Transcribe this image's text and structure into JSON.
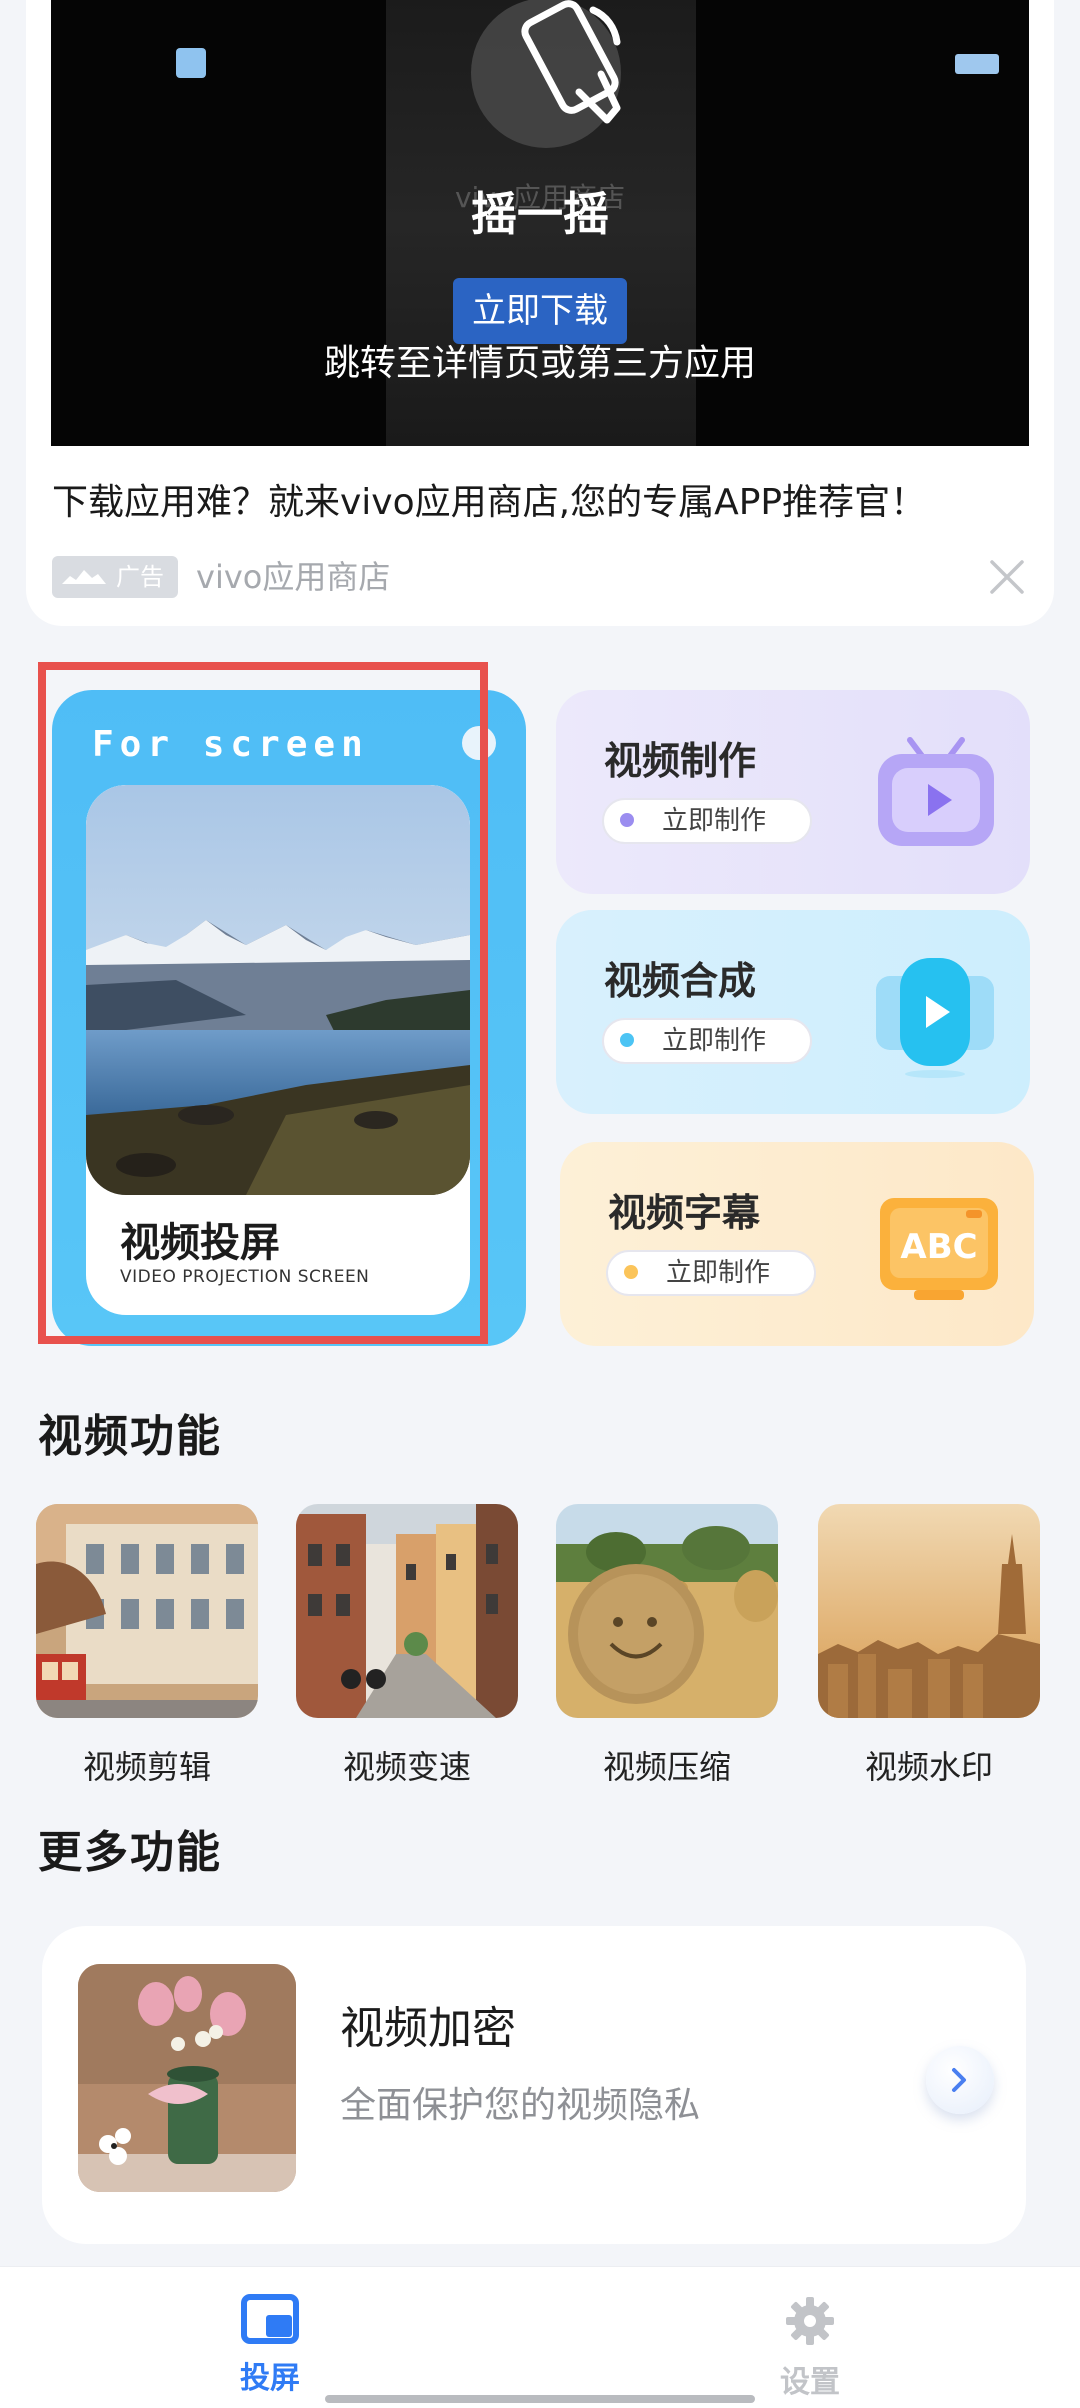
{
  "ad": {
    "shake_text": "摇一摇",
    "store_caption": "vivo应用商店",
    "download_label": "立即下载",
    "jump_text": "跳转至详情页或第三方应用",
    "headline": "下载应用难？就来vivo应用商店,您的专属APP推荐官！",
    "badge": "广告",
    "store_name": "vivo应用商店"
  },
  "cast": {
    "title_en": "For screen",
    "name": "视频投屏",
    "subtitle": "VIDEO PROJECTION SCREEN"
  },
  "features": [
    {
      "title": "视频制作",
      "button": "立即制作",
      "icon": "tv-play-icon",
      "color": "#9b8df0"
    },
    {
      "title": "视频合成",
      "button": "立即制作",
      "icon": "video-play-icon",
      "color": "#35c4f3"
    },
    {
      "title": "视频字幕",
      "button": "立即制作",
      "icon": "abc-board-icon",
      "color": "#fbb13c"
    }
  ],
  "sections": {
    "video_functions": "视频功能",
    "more_functions": "更多功能"
  },
  "video_functions": [
    {
      "label": "视频剪辑"
    },
    {
      "label": "视频变速"
    },
    {
      "label": "视频压缩"
    },
    {
      "label": "视频水印"
    }
  ],
  "more": {
    "title": "视频加密",
    "desc": "全面保护您的视频隐私"
  },
  "nav": {
    "cast_label": "投屏",
    "settings_label": "设置",
    "active_color": "#2f7bf5",
    "inactive_color": "#c2c4c8"
  }
}
